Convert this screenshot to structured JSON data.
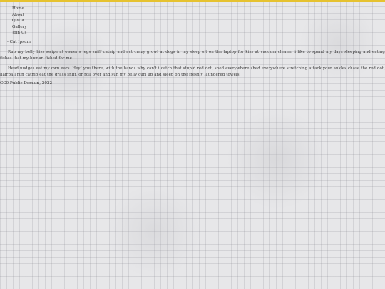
{
  "nav": {
    "items": [
      {
        "label": "Home"
      },
      {
        "label": "About"
      },
      {
        "label": "Q & A"
      },
      {
        "label": "Gallery"
      },
      {
        "label": "Join Us"
      }
    ]
  },
  "subtitle": "- Cat Ipsum",
  "paragraphs": [
    "Rub my belly hiss swipe at owner's legs sniff catnip and act crazy growl at dogs in my sleep sit on the laptop for kiss at vacuum cleaner i like to spend my days sleeping and eating fishes that my human fished for me.",
    "Head nudges eat my own ears. Hey! you there, with the hands why can't i catch that stupid red dot, shed everywhere shed everywhere stretching attack your ankles chase the red dot, hairball run catnip eat the grass sniff, or roll over and sun my belly curl up and sleep on the freshly laundered towels."
  ],
  "footer": "CC0 Public Domain, 2022",
  "colors": {
    "accent_bar": "#e6c230",
    "background": "#e7e7e9",
    "text": "#333333"
  }
}
